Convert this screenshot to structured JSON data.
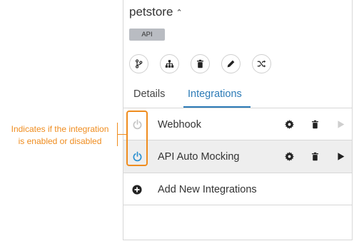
{
  "api": {
    "name": "petstore",
    "type_badge": "API"
  },
  "toolbar": {
    "buttons": [
      {
        "name": "branch-button",
        "icon": "branch-icon"
      },
      {
        "name": "hierarchy-button",
        "icon": "sitemap-icon"
      },
      {
        "name": "delete-api-button",
        "icon": "trash-icon"
      },
      {
        "name": "edit-button",
        "icon": "pencil-icon"
      },
      {
        "name": "shuffle-button",
        "icon": "shuffle-icon"
      }
    ]
  },
  "tabs": {
    "details": "Details",
    "integrations": "Integrations",
    "active": "integrations"
  },
  "integrations": [
    {
      "label": "Webhook",
      "enabled": false,
      "power_color": "#c4c4c4",
      "run_color": "#cfcfcf"
    },
    {
      "label": "API Auto Mocking",
      "enabled": true,
      "power_color": "#2b8fd0",
      "run_color": "#222222"
    }
  ],
  "add_new": {
    "label": "Add New Integrations"
  },
  "annotation": {
    "line1": "Indicates if the integration",
    "line2": "is enabled or disabled",
    "color": "#ef8c1e"
  }
}
